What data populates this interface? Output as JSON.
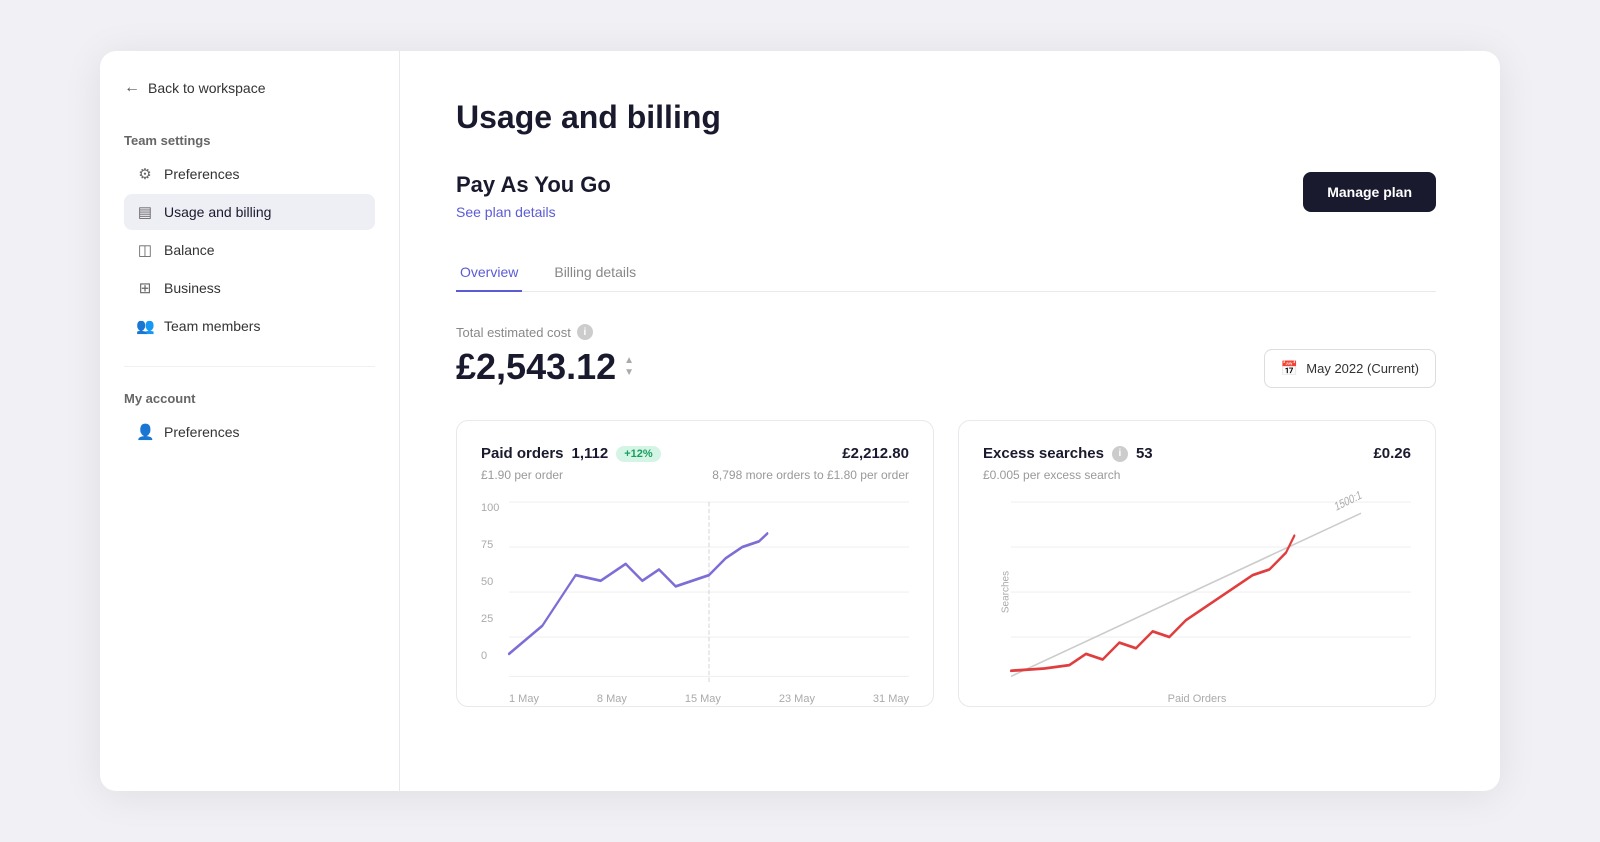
{
  "sidebar": {
    "back_label": "Back to workspace",
    "team_settings_label": "Team settings",
    "my_account_label": "My account",
    "team_items": [
      {
        "id": "preferences",
        "label": "Preferences",
        "icon": "⚙"
      },
      {
        "id": "usage-billing",
        "label": "Usage and billing",
        "icon": "▤",
        "active": true
      },
      {
        "id": "balance",
        "label": "Balance",
        "icon": "◫"
      },
      {
        "id": "business",
        "label": "Business",
        "icon": "⊞"
      },
      {
        "id": "team-members",
        "label": "Team members",
        "icon": "👥"
      }
    ],
    "account_items": [
      {
        "id": "account-preferences",
        "label": "Preferences",
        "icon": "👤"
      }
    ]
  },
  "main": {
    "page_title": "Usage and billing",
    "plan_name": "Pay As You Go",
    "plan_link": "See plan details",
    "manage_plan_btn": "Manage plan",
    "tabs": [
      {
        "id": "overview",
        "label": "Overview",
        "active": true
      },
      {
        "id": "billing-details",
        "label": "Billing details",
        "active": false
      }
    ],
    "cost_label": "Total estimated cost",
    "cost_amount": "£2,543.12",
    "date_btn": "May 2022 (Current)",
    "cards": [
      {
        "title": "Paid orders",
        "count": "1,112",
        "badge": "+12%",
        "amount": "£2,212.80",
        "subtitle_left": "£1.90 per order",
        "subtitle_right": "8,798 more orders to £1.80 per order",
        "chart_type": "line_purple",
        "y_labels": [
          "100",
          "75",
          "50",
          "25",
          "0"
        ],
        "x_labels": [
          "1 May",
          "8 May",
          "15 May",
          "23 May",
          "31 May"
        ]
      },
      {
        "title": "Excess searches",
        "count": "53",
        "badge": null,
        "amount": "£0.26",
        "subtitle_left": "£0.005 per excess search",
        "subtitle_right": "",
        "chart_type": "line_red",
        "y_label_side": "Searches",
        "x_label": "Paid Orders",
        "diagonal_label": "1500:1"
      }
    ]
  },
  "icons": {
    "back_arrow": "←",
    "gear": "⚙",
    "calendar": "📅",
    "info": "i",
    "chevron_up": "▲",
    "chevron_down": "▼"
  }
}
